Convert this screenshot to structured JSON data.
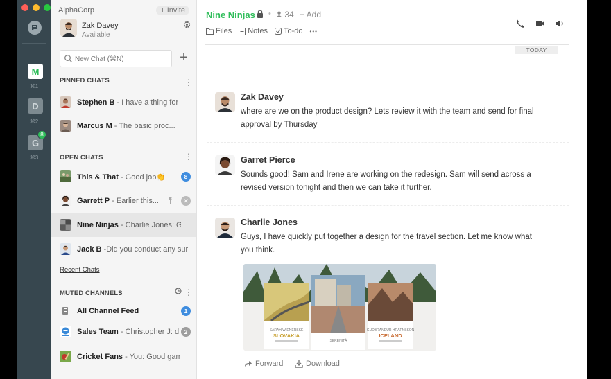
{
  "workspace": {
    "org_name": "AlphaCorp",
    "invite_label": "+ Invite",
    "user_name": "Zak Davey",
    "user_status": "Available",
    "workspaces": [
      {
        "letter": "M",
        "shortcut": "⌘1"
      },
      {
        "letter": "D",
        "shortcut": "⌘2"
      },
      {
        "letter": "G",
        "shortcut": "⌘3",
        "badge": "8"
      }
    ]
  },
  "search": {
    "placeholder": "New Chat (⌘N)"
  },
  "sections": {
    "pinned": "PINNED CHATS",
    "open": "OPEN CHATS",
    "muted": "MUTED CHANNELS",
    "recent_link": "Recent Chats"
  },
  "pinned_chats": [
    {
      "name": "Stephen B",
      "preview": " - I have a thing for"
    },
    {
      "name": "Marcus M",
      "preview": " - The basic proc..."
    }
  ],
  "open_chats": [
    {
      "name": "This & That",
      "preview": " - Good job👏",
      "badge": "8"
    },
    {
      "name": "Garrett P",
      "preview": " - Earlier this..."
    },
    {
      "name": "Nine Ninjas",
      "preview": " - Charlie Jones: G..."
    },
    {
      "name": "Jack B",
      "preview": " -Did you conduct any sur"
    }
  ],
  "muted_channels": [
    {
      "name": "All Channel Feed",
      "preview": "",
      "badge": "1"
    },
    {
      "name": "Sales Team",
      "preview": " - Christopher J: d...",
      "badge": "2"
    },
    {
      "name": "Cricket Fans",
      "preview": " - You: Good game"
    }
  ],
  "header": {
    "title": "Nine Ninjas",
    "members": "34",
    "add_label": "+ Add",
    "tabs": [
      "Files",
      "Notes",
      "To-do"
    ],
    "more": "•••"
  },
  "date_divider": "TODAY",
  "messages": [
    {
      "author": "Zak Davey",
      "text": "where are we on the product design? Lets review it with the team and send for final approval by Thursday"
    },
    {
      "author": "Garret Pierce",
      "text": "Sounds good! Sam and Irene are working on the redesign. Sam will send across a revised version tonight and then we can take it further."
    },
    {
      "author": "Charlie Jones",
      "text": "Guys, I have quickly put together a design for the travel section. Let me know what you think."
    }
  ],
  "attachment": {
    "labels": [
      "SLOVAKIA",
      "ICELAND"
    ],
    "actions": [
      "Forward",
      "Download"
    ]
  },
  "colors": {
    "accent": "#2ebd59",
    "rail": "#37474f",
    "badge_blue": "#3f8ddf"
  }
}
